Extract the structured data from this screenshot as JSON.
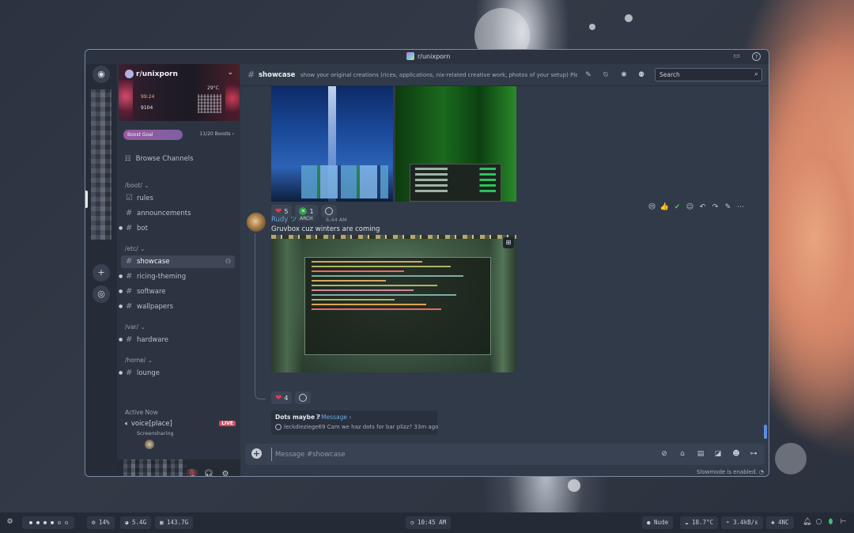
{
  "window": {
    "title": "r/unixporn"
  },
  "server": {
    "name": "r/unixporn",
    "banner_clock": "99:24",
    "banner_clock2": "9104",
    "banner_temp": "29°C",
    "boost_goal_label": "Boost Goal",
    "boost_count": "11/20 Boosts ›"
  },
  "sidebar": {
    "browse_channels": "Browse Channels",
    "categories": [
      {
        "label": "/boot/ ⌄",
        "channels": [
          "rules",
          "announcements",
          "bot"
        ]
      },
      {
        "label": "/etc/ ⌄",
        "channels": [
          "showcase",
          "ricing-theming",
          "software",
          "wallpapers"
        ]
      },
      {
        "label": "/var/ ⌄",
        "channels": [
          "hardware"
        ]
      },
      {
        "label": "/home/ ⌄",
        "channels": [
          "lounge"
        ]
      }
    ],
    "active_now": "Active Now",
    "voice_channel": "voice[place]",
    "voice_sub": "Screensharing",
    "live_badge": "LIVE"
  },
  "channel": {
    "name": "showcase",
    "topic": "show your original creations (rices, applications, nix-related creative work, photos of your setup) Plea...",
    "search_placeholder": "Search"
  },
  "messages": {
    "first_reactions": [
      {
        "emoji": "heart",
        "count": "5"
      },
      {
        "emoji": "xbox",
        "count": "1"
      }
    ],
    "second": {
      "author": "Rudy ツ",
      "tag": "ARCH",
      "time": "6:44 AM",
      "text": "Gruvbox cuz winters are coming",
      "reactions": [
        {
          "emoji": "heart",
          "count": "4"
        }
      ]
    },
    "thread": {
      "name": "Dots maybe ?",
      "count": "1 Message ›",
      "preview": "leckdieziege69 Cam we haz dots for bar plizz?  33m ago"
    }
  },
  "composer": {
    "placeholder": "Message #showcase",
    "slowmode": "Slowmode is enabled."
  },
  "taskbar": {
    "cpu": "14%",
    "ram": "5.4G",
    "disk": "143.7G",
    "clock": "10:45 AM",
    "media": "Nude",
    "weather": "18.7°C",
    "net": "3.4kB/s",
    "bt": "4NC"
  }
}
